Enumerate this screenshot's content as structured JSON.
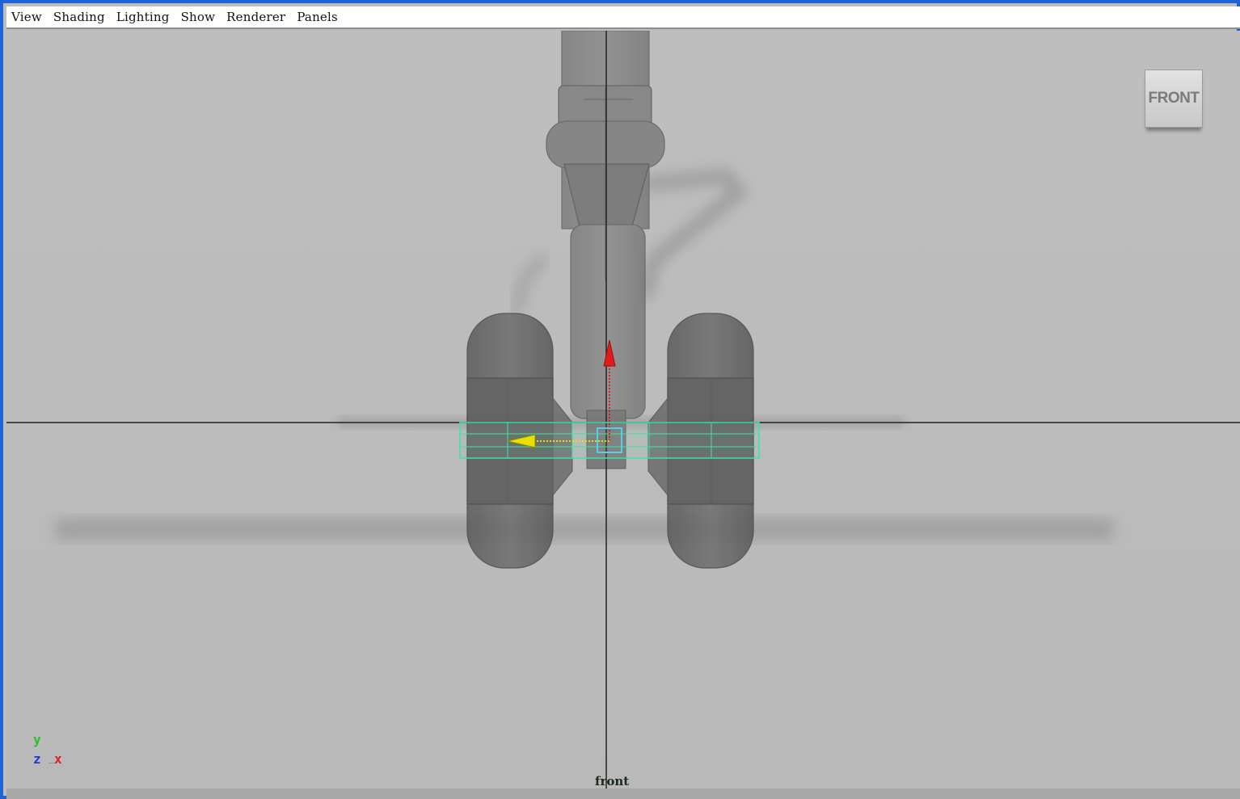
{
  "menubar": {
    "items": [
      "View",
      "Shading",
      "Lighting",
      "Show",
      "Renderer",
      "Panels"
    ]
  },
  "viewport": {
    "camera_name": "front",
    "viewcube_label": "FRONT",
    "axis": {
      "y": "y",
      "z": "z",
      "x": "x"
    }
  },
  "colors": {
    "frame": "#1f63d8",
    "viewport_bg": "#bdbdbd",
    "selection": "#43e0a8",
    "manipulator_y": "#e21b1b",
    "manipulator_x": "#e8e000",
    "axis_y": "#2ac02a",
    "axis_z": "#1a36e0",
    "axis_x": "#e02020"
  },
  "icons": {
    "viewcube": "viewcube-icon",
    "axis_gizmo": "axis-gizmo-icon",
    "move_manipulator": "move-manipulator-icon"
  }
}
